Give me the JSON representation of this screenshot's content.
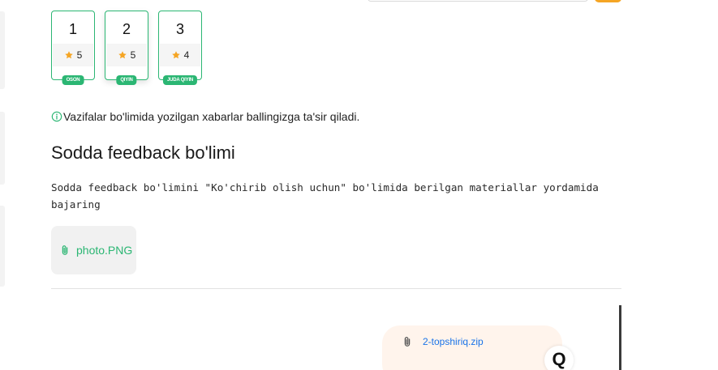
{
  "levels": [
    {
      "number": "1",
      "rating": "5",
      "badge": "OSON"
    },
    {
      "number": "2",
      "rating": "5",
      "badge": "QIYIN"
    },
    {
      "number": "3",
      "rating": "4",
      "badge": "JUDA QIYIN"
    }
  ],
  "notice": {
    "text": "Vazifalar bo'limida yozilgan xabarlar ballingizga ta'sir qiladi."
  },
  "section": {
    "title": "Sodda feedback bo'limi",
    "description": "Sodda feedback bo'limini \"Ko'chirib olish uchun\" bo'limida berilgan materiallar yordamida bajaring",
    "attachment": "photo.PNG"
  },
  "chat": {
    "file_name": "2-topshiriq.zip",
    "avatar_letter": "Q"
  },
  "colors": {
    "accent_green": "#2bb673",
    "link_blue": "#1a73e8",
    "star": "#f5a524",
    "chat_bubble": "#fff4ec"
  },
  "icons": {
    "star": "star-icon",
    "info": "info-icon",
    "attachment": "paperclip-icon"
  }
}
